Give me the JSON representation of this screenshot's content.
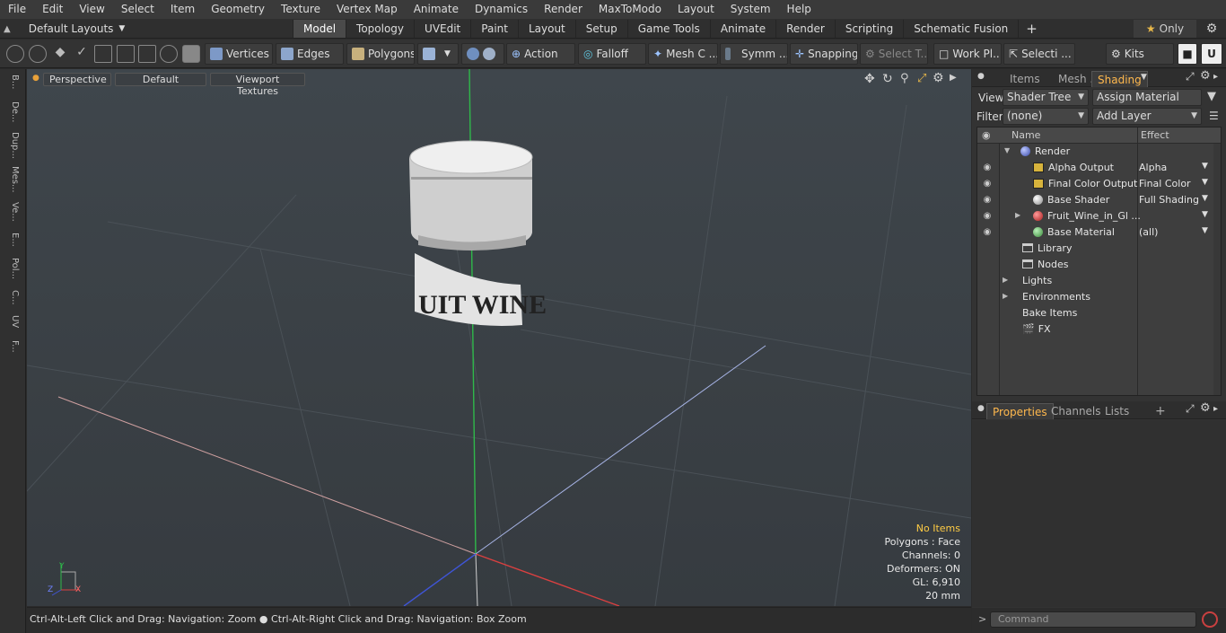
{
  "menubar": {
    "items": [
      "File",
      "Edit",
      "View",
      "Select",
      "Item",
      "Geometry",
      "Texture",
      "Vertex Map",
      "Animate",
      "Dynamics",
      "Render",
      "MaxToModo",
      "Layout",
      "System",
      "Help"
    ]
  },
  "layout": {
    "selector": "Default Layouts",
    "tabs": [
      "Model",
      "Topology",
      "UVEdit",
      "Paint",
      "Layout",
      "Setup",
      "Game Tools",
      "Animate",
      "Render",
      "Scripting",
      "Schematic Fusion"
    ],
    "active_tab": "Model",
    "add_tab": "+",
    "only_label": "Only"
  },
  "toolbar": {
    "vertices": "Vertices",
    "edges": "Edges",
    "polygons": "Polygons",
    "action": "Action",
    "falloff": "Falloff",
    "mesh_c": "Mesh C ...",
    "symm": "Symm ...",
    "snapping": "Snapping",
    "select_t": "Select T...",
    "work_pl": "Work Pl...",
    "selecti": "Selecti ...",
    "kits": "Kits"
  },
  "leftstrip": {
    "tabs": [
      "B...",
      "De...",
      "Dup...",
      "Mes...",
      "Ve...",
      "E...",
      "Pol...",
      "C...",
      "UV",
      "F..."
    ]
  },
  "viewport": {
    "perspective": "Perspective",
    "default": "Default",
    "textures": "Viewport Textures",
    "label_text": "UIT WINE",
    "info": {
      "no_items": "No Items",
      "polygons": "Polygons : Face",
      "channels": "Channels: 0",
      "deformers": "Deformers: ON",
      "gl": "GL: 6,910",
      "scale": "20 mm"
    },
    "axis": {
      "y": "Y",
      "z": "Z",
      "x": "X"
    }
  },
  "status": {
    "hint1": "Ctrl-Alt-Left Click and Drag: Navigation: Zoom",
    "hint2": "Ctrl-Alt-Right Click and Drag: Navigation: Box Zoom"
  },
  "rpanel": {
    "tabs": [
      "Items",
      "Mesh ...",
      "Shading"
    ],
    "active_tab": "Shading",
    "view_label": "View",
    "view_value": "Shader Tree",
    "assign": "Assign Material",
    "filter_label": "Filter",
    "filter_value": "(none)",
    "add_layer": "Add Layer",
    "tree": {
      "col_name": "Name",
      "col_effect": "Effect",
      "rows": [
        {
          "name": "Render",
          "effect": ""
        },
        {
          "name": "Alpha Output",
          "effect": "Alpha"
        },
        {
          "name": "Final Color Output",
          "effect": "Final Color"
        },
        {
          "name": "Base Shader",
          "effect": "Full Shading"
        },
        {
          "name": "Fruit_Wine_in_Gl ...",
          "effect": ""
        },
        {
          "name": "Base Material",
          "effect": "(all)"
        },
        {
          "name": "Library",
          "effect": ""
        },
        {
          "name": "Nodes",
          "effect": ""
        },
        {
          "name": "Lights",
          "effect": ""
        },
        {
          "name": "Environments",
          "effect": ""
        },
        {
          "name": "Bake Items",
          "effect": ""
        },
        {
          "name": "FX",
          "effect": ""
        }
      ]
    },
    "prop_tabs": [
      "Properties",
      "Channels",
      "Lists"
    ],
    "prop_add": "+",
    "command_placeholder": "Command"
  }
}
